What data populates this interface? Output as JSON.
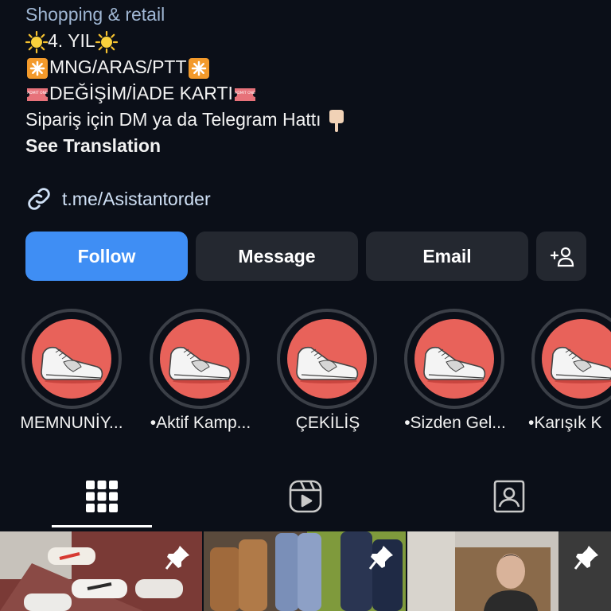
{
  "profile": {
    "category": "Shopping & retail",
    "bio_lines": [
      "4. YIL",
      "MNG/ARAS/PTT",
      "DEĞİŞİM/İADE KARTI",
      "Sipariş için DM ya da Telegram Hattı"
    ],
    "see_translation": "See Translation",
    "link": "t.me/Asistantorder",
    "ticket_text": "ADMIT ONE"
  },
  "actions": {
    "follow": "Follow",
    "message": "Message",
    "email": "Email"
  },
  "highlights": [
    {
      "label": "MEMNUNİY..."
    },
    {
      "label": "•Aktif Kamp..."
    },
    {
      "label": "ÇEKİLİŞ"
    },
    {
      "label": "•Sizden Gel..."
    },
    {
      "label": "•Karışık K"
    }
  ],
  "tabs": [
    "grid-icon",
    "reels-icon",
    "tagged-icon"
  ],
  "colors": {
    "accent": "#3f8ef4",
    "highlight_bg": "#e8625a",
    "background": "#0b0f18"
  }
}
